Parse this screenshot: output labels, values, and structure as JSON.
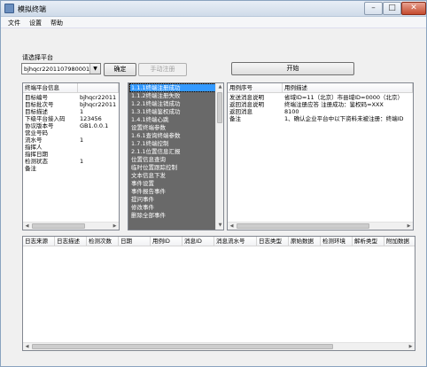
{
  "window": {
    "title": "模拟终端"
  },
  "menu": [
    "文件",
    "设置",
    "帮助"
  ],
  "platform": {
    "label": "请选择平台",
    "selected": "bjhqcr2201107980001",
    "confirm_label": "确定",
    "manual_label": "手动注册",
    "start_label": "开始"
  },
  "info_table": {
    "columns": [
      "终端平台信息",
      ""
    ],
    "rows": [
      [
        "目标编号",
        "bjhqcr22011"
      ],
      [
        "目标批次号",
        "bjhqcr22011"
      ],
      [
        "目标描述",
        "1"
      ],
      [
        "下级平台接入码",
        "123456"
      ],
      [
        "协议版本号",
        "GB1.0.0.1"
      ],
      [
        "营业号码",
        ""
      ],
      [
        "流水号",
        "1"
      ],
      [
        "指挥人",
        ""
      ],
      [
        "指挥日期",
        ""
      ],
      [
        "检测状态",
        "1"
      ],
      [
        "备注",
        ""
      ]
    ]
  },
  "test_cases": [
    "1.1.1终端注册成功",
    "1.1.2终端注册失败",
    "1.2.1终端注销成功",
    "1.3.1终端鉴权成功",
    "1.4.1终端心跳",
    "设置终端参数",
    "1.6.1查询终端参数",
    "1.7.1终端控制",
    "2.1.1位置信息汇报",
    "位置信息查询",
    "临时位置跟踪控制",
    "文本信息下发",
    "事件设置",
    "事件报告事件",
    "提问事件",
    "修改事件",
    "删除全部事件"
  ],
  "result_table": {
    "columns": [
      "用例序号",
      "用例描述"
    ],
    "rows": [
      [
        "发送消息说明",
        "省域ID=11（北京）市县域ID=0000（北京）"
      ],
      [
        "返回消息说明",
        "终端注册应答 注册成功：鉴权码=XXX"
      ],
      [
        "返回消息",
        "8100"
      ],
      [
        "备注",
        "1、确认企业平台中以下资料未被注册：终端ID"
      ]
    ]
  },
  "log_table": {
    "columns": [
      "日志来源",
      "日志描述",
      "检测次数",
      "日期",
      "用例ID",
      "消息ID",
      "消息流水号",
      "日志类型",
      "原始数据",
      "检测环境",
      "解析类型",
      "附加数据"
    ]
  },
  "colors": {
    "selection": "#3399ff",
    "listbox_bg": "#696969"
  }
}
